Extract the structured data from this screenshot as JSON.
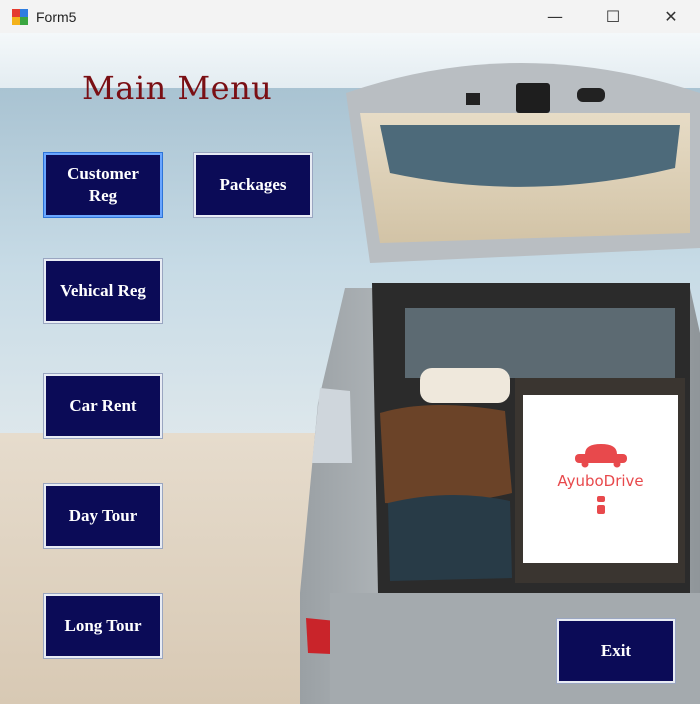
{
  "window": {
    "title": "Form5",
    "controls": {
      "minimize": "—",
      "maximize": "☐",
      "close": "✕"
    }
  },
  "main": {
    "heading": "Main Menu",
    "buttons": {
      "customer_reg": "Customer Reg",
      "packages": "Packages",
      "vehical_reg": "Vehical Reg",
      "car_rent": "Car Rent",
      "day_tour": "Day Tour",
      "long_tour": "Long Tour",
      "exit": "Exit"
    }
  },
  "logo": {
    "text": "AyuboDrive"
  },
  "colors": {
    "heading": "#7a0f14",
    "button_bg": "#0b0b57",
    "logo_accent": "#e8494c"
  }
}
